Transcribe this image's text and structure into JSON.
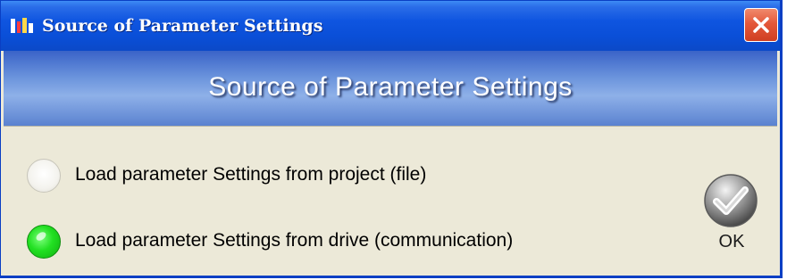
{
  "window": {
    "title": "Source of Parameter Settings",
    "close_label": "Close"
  },
  "banner": {
    "title": "Source of Parameter Settings"
  },
  "options": [
    {
      "label": "Load parameter Settings from project (file)",
      "selected": false
    },
    {
      "label": "Load parameter Settings from drive (communication)",
      "selected": true
    }
  ],
  "ok_button": {
    "label": "OK"
  },
  "colors": {
    "titlebar": "#0a4fd8",
    "banner": "#6a93dc",
    "selected_radio": "#22e022",
    "close_button": "#e4583a",
    "body_background": "#ece9d8"
  },
  "icons": {
    "app": "app-logo-icon",
    "close": "close-icon",
    "ok": "checkmark-icon"
  }
}
